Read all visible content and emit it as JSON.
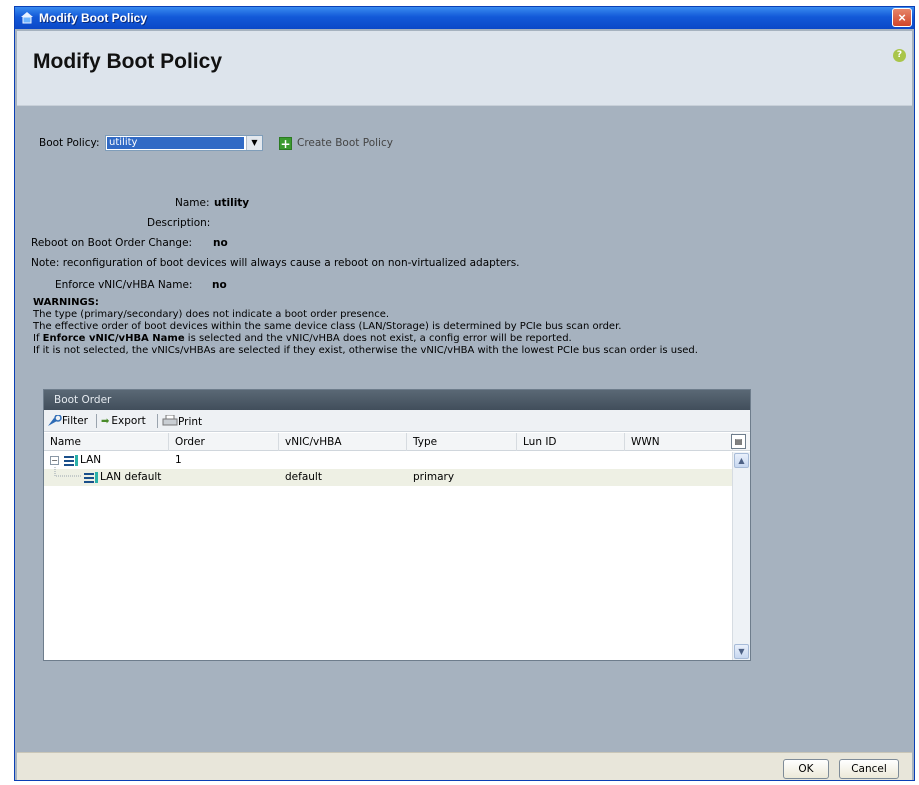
{
  "window": {
    "title": "Modify Boot Policy",
    "close_glyph": "×"
  },
  "header": {
    "title": "Modify Boot Policy",
    "help_glyph": "?"
  },
  "form": {
    "boot_policy_label": "Boot Policy:",
    "boot_policy_value": "utility",
    "create_link": "Create Boot Policy",
    "name_label": "Name:",
    "name_value": "utility",
    "description_label": "Description:",
    "description_value": "",
    "reboot_label": "Reboot on Boot Order Change:",
    "reboot_value": "no",
    "note": "Note: reconfiguration of boot devices will always cause a reboot on non-virtualized adapters.",
    "enforce_label": "Enforce vNIC/vHBA Name:",
    "enforce_value": "no"
  },
  "warnings": {
    "heading": "WARNINGS:",
    "line1": "The type (primary/secondary) does not indicate a boot order presence.",
    "line2": "The effective order of boot devices within the same device class (LAN/Storage) is determined by PCIe bus scan order.",
    "line3_prefix": "If ",
    "line3_bold": "Enforce vNIC/vHBA Name",
    "line3_suffix": " is selected and the vNIC/vHBA does not exist, a config error will be reported.",
    "line4": "If it is not selected, the vNICs/vHBAs are selected if they exist, otherwise the vNIC/vHBA with the lowest PCIe bus scan order is used."
  },
  "boot_order": {
    "title": "Boot Order",
    "toolbar": {
      "filter": "Filter",
      "export": "Export",
      "print": "Print"
    },
    "columns": [
      "Name",
      "Order",
      "vNIC/vHBA",
      "Type",
      "Lun ID",
      "WWN"
    ],
    "rows": [
      {
        "name": "LAN",
        "order": "1",
        "vnic": "",
        "type": "",
        "lun": "",
        "wwn": ""
      },
      {
        "name": "LAN default",
        "order": "",
        "vnic": "default",
        "type": "primary",
        "lun": "",
        "wwn": ""
      }
    ]
  },
  "footer": {
    "ok": "OK",
    "cancel": "Cancel"
  }
}
